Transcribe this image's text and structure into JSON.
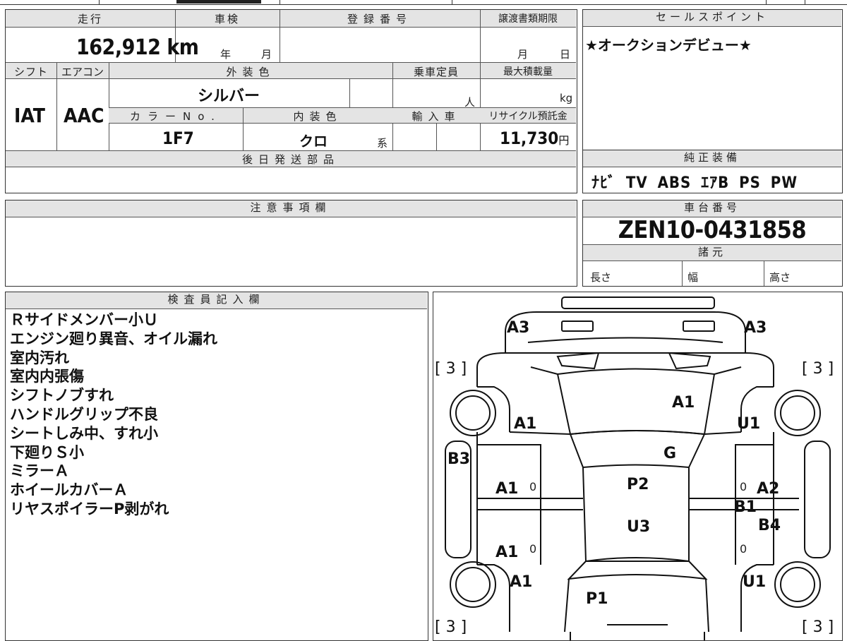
{
  "vehicle": {
    "mileage_label": "走行",
    "mileage": "162,912",
    "mileage_unit": "km",
    "inspection_label": "車検",
    "inspection_year_unit": "年",
    "inspection_month_unit": "月",
    "registration_label": "登録番号",
    "transfer_deadline_label": "譲渡書類期限",
    "transfer_month_unit": "月",
    "transfer_day_unit": "日",
    "shift_label": "シフト",
    "shift": "IAT",
    "aircon_label": "エアコン",
    "aircon": "AAC",
    "exterior_color_label": "外装色",
    "exterior_color": "シルバー",
    "capacity_label": "乗車定員",
    "capacity_unit": "人",
    "max_load_label": "最大積載量",
    "max_load_unit": "kg",
    "color_no_label": "カラーNo.",
    "color_no": "1F7",
    "interior_color_label": "内装色",
    "interior_color": "クロ",
    "interior_color_suffix": "系",
    "import_label": "輸入車",
    "recycle_label": "リサイクル預託金",
    "recycle_fee": "11,730",
    "recycle_unit": "円",
    "later_parts_label": "後日発送部品"
  },
  "sales_point": {
    "label": "セールスポイント",
    "text": "★オークションデビュー★"
  },
  "equipment": {
    "label": "純正装備",
    "items": "ﾅﾋﾞ TV ABS ｴｱB PS PW"
  },
  "caution": {
    "label": "注意事項欄"
  },
  "chassis": {
    "label": "車台番号",
    "number": "ZEN10-0431858"
  },
  "specs": {
    "label": "諸元",
    "length": "長さ",
    "width": "幅",
    "height": "高さ"
  },
  "inspector": {
    "label": "検査員記入欄",
    "notes": [
      "Ｒサイドメンバー小Ｕ",
      "エンジン廻り異音、オイル漏れ",
      "室内汚れ",
      "室内内張傷",
      "シフトノブすれ",
      "ハンドルグリップ不良",
      "シートしみ中、すれ小",
      "下廻りＳ小",
      "ミラーＡ",
      "ホイールカバーＡ",
      "リヤスポイラーP剥がれ"
    ]
  },
  "diagram": {
    "marks": {
      "bumper_left": "A3",
      "bumper_right": "A3",
      "tire_front_left": "[ 3 ]",
      "tire_front_right": "[ 3 ]",
      "tire_rear_left": "[ 3 ]",
      "tire_rear_right": "[ 3 ]",
      "hood": "A1",
      "front_fender_left": "A1",
      "front_fender_right": "U1",
      "windshield": "G",
      "side_sill_left": "B3",
      "front_door_left": "A1",
      "front_door_right": "A2",
      "pillar_right": "B1",
      "rear_door_right": "B4",
      "roof_front": "P2",
      "roof_rear": "U3",
      "rear_door_left": "A1",
      "rear_fender_left": "A1",
      "rear_fender_right": "U1",
      "trunk": "P1",
      "zero_1": "0",
      "zero_2": "0",
      "zero_3": "0",
      "zero_4": "0"
    }
  }
}
